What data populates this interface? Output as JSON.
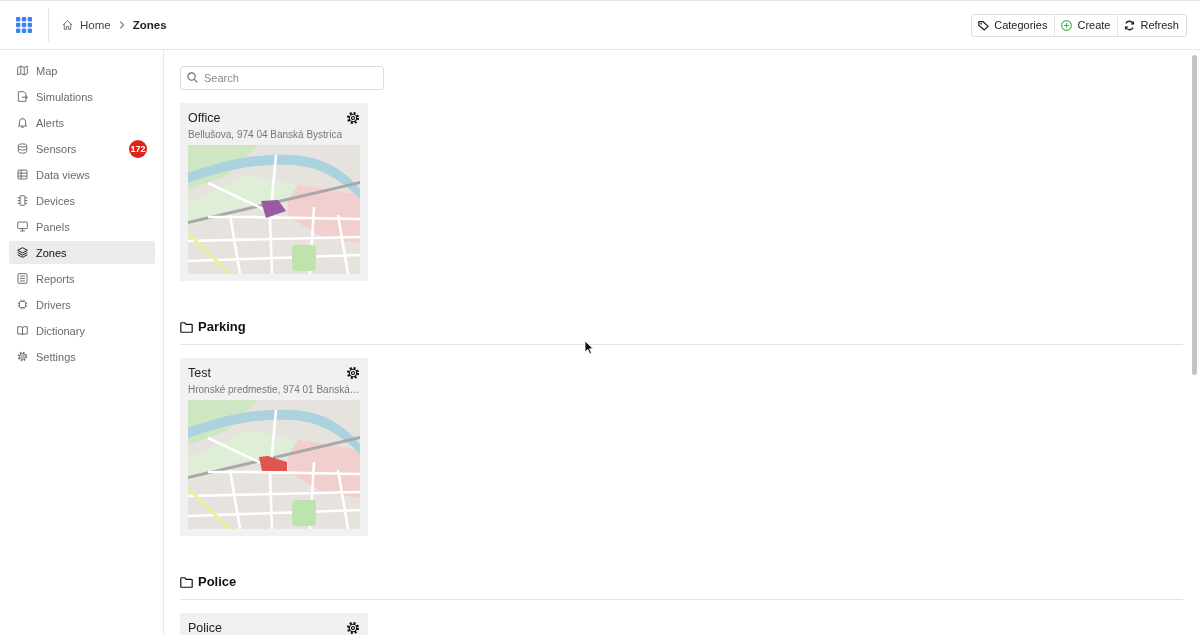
{
  "header": {
    "breadcrumb": [
      {
        "label": "Home",
        "kind": "home",
        "current": false
      },
      {
        "label": "Zones",
        "kind": "page",
        "current": true
      }
    ],
    "actions": [
      {
        "label": "Categories",
        "kind": "tag"
      },
      {
        "label": "Create",
        "kind": "create"
      },
      {
        "label": "Refresh",
        "kind": "refresh"
      }
    ]
  },
  "sidebar": {
    "items": [
      {
        "label": "Map",
        "kind": "map",
        "selected": false
      },
      {
        "label": "Simulations",
        "kind": "simulations",
        "selected": false
      },
      {
        "label": "Alerts",
        "kind": "alerts",
        "selected": false
      },
      {
        "label": "Sensors",
        "kind": "sensors",
        "selected": false,
        "badge": "172"
      },
      {
        "label": "Data views",
        "kind": "dataviews",
        "selected": false
      },
      {
        "label": "Devices",
        "kind": "devices",
        "selected": false
      },
      {
        "label": "Panels",
        "kind": "panels",
        "selected": false
      },
      {
        "label": "Zones",
        "kind": "zones",
        "selected": true
      },
      {
        "label": "Reports",
        "kind": "reports",
        "selected": false
      },
      {
        "label": "Drivers",
        "kind": "drivers",
        "selected": false
      },
      {
        "label": "Dictionary",
        "kind": "dictionary",
        "selected": false
      },
      {
        "label": "Settings",
        "kind": "settings",
        "selected": false
      }
    ]
  },
  "search": {
    "placeholder": "Search"
  },
  "zones": [
    {
      "name": "Office",
      "address": "Bellušova, 974 04 Banská Bystrica",
      "color": "#9b59a6"
    }
  ],
  "groups": [
    {
      "title": "Parking",
      "zones": [
        {
          "name": "Test",
          "address": "Hronské predmestie, 974 01 Banská…",
          "color": "#e0564f"
        }
      ]
    },
    {
      "title": "Police",
      "zones": [
        {
          "name": "Police"
        }
      ]
    }
  ]
}
